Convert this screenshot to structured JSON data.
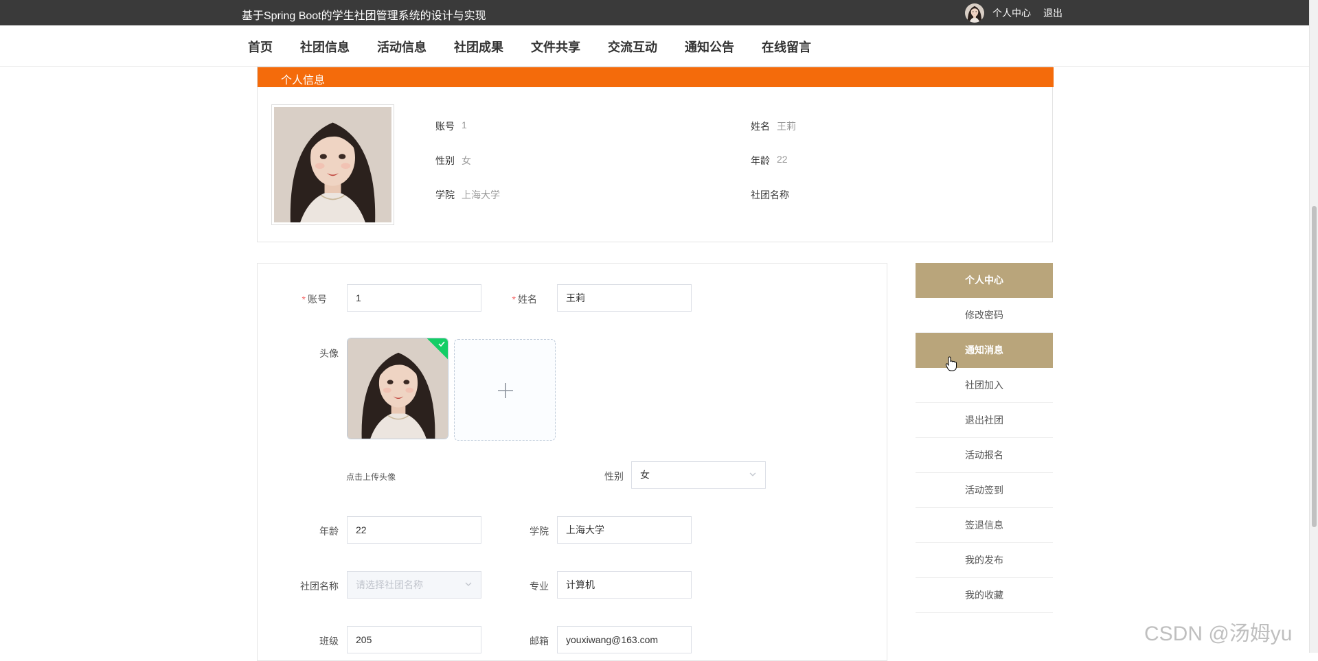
{
  "site": {
    "title": "基于Spring Boot的学生社团管理系统的设计与实现",
    "user_center": "个人中心",
    "logout": "退出"
  },
  "nav": {
    "items": [
      "首页",
      "社团信息",
      "活动信息",
      "社团成果",
      "文件共享",
      "交流互动",
      "通知公告",
      "在线留言"
    ]
  },
  "profile": {
    "header": "个人信息",
    "account_label": "账号",
    "account_value": "1",
    "name_label": "姓名",
    "name_value": "王莉",
    "gender_label": "性别",
    "gender_value": "女",
    "age_label": "年龄",
    "age_value": "22",
    "college_label": "学院",
    "college_value": "上海大学",
    "club_label": "社团名称",
    "club_value": ""
  },
  "form": {
    "account_label": "账号",
    "account_value": "1",
    "name_label": "姓名",
    "name_value": "王莉",
    "avatar_label": "头像",
    "upload_hint": "点击上传头像",
    "gender_label": "性别",
    "gender_value": "女",
    "age_label": "年龄",
    "age_value": "22",
    "college_label": "学院",
    "college_value": "上海大学",
    "club_label": "社团名称",
    "club_placeholder": "请选择社团名称",
    "major_label": "专业",
    "major_value": "计算机",
    "class_label": "班级",
    "class_value": "205",
    "email_label": "邮箱",
    "email_value": "youxiwang@163.com"
  },
  "side_menu": {
    "items": [
      "个人中心",
      "修改密码",
      "通知消息",
      "社团加入",
      "退出社团",
      "活动报名",
      "活动签到",
      "签退信息",
      "我的发布",
      "我的收藏"
    ]
  },
  "watermark": "CSDN @汤姆yu",
  "colors": {
    "topbar": "#3a3a3a",
    "profile_header": "#f46b0b",
    "menu_active": "#b9a57b",
    "upload_success": "#13ce66"
  }
}
